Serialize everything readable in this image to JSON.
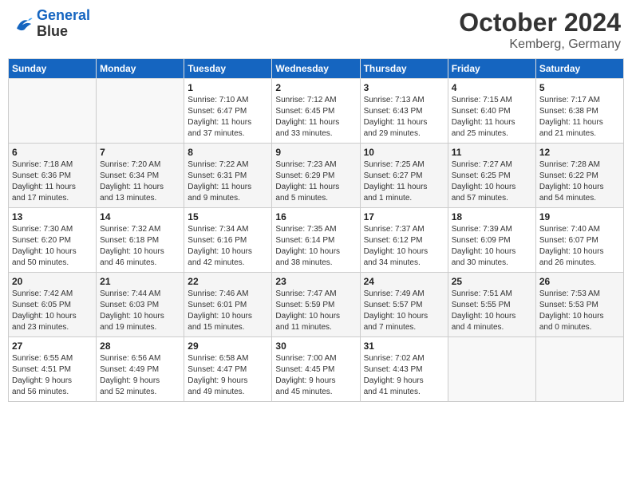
{
  "header": {
    "logo_line1": "General",
    "logo_line2": "Blue",
    "month": "October 2024",
    "location": "Kemberg, Germany"
  },
  "days_of_week": [
    "Sunday",
    "Monday",
    "Tuesday",
    "Wednesday",
    "Thursday",
    "Friday",
    "Saturday"
  ],
  "weeks": [
    [
      {
        "num": "",
        "detail": ""
      },
      {
        "num": "",
        "detail": ""
      },
      {
        "num": "1",
        "detail": "Sunrise: 7:10 AM\nSunset: 6:47 PM\nDaylight: 11 hours\nand 37 minutes."
      },
      {
        "num": "2",
        "detail": "Sunrise: 7:12 AM\nSunset: 6:45 PM\nDaylight: 11 hours\nand 33 minutes."
      },
      {
        "num": "3",
        "detail": "Sunrise: 7:13 AM\nSunset: 6:43 PM\nDaylight: 11 hours\nand 29 minutes."
      },
      {
        "num": "4",
        "detail": "Sunrise: 7:15 AM\nSunset: 6:40 PM\nDaylight: 11 hours\nand 25 minutes."
      },
      {
        "num": "5",
        "detail": "Sunrise: 7:17 AM\nSunset: 6:38 PM\nDaylight: 11 hours\nand 21 minutes."
      }
    ],
    [
      {
        "num": "6",
        "detail": "Sunrise: 7:18 AM\nSunset: 6:36 PM\nDaylight: 11 hours\nand 17 minutes."
      },
      {
        "num": "7",
        "detail": "Sunrise: 7:20 AM\nSunset: 6:34 PM\nDaylight: 11 hours\nand 13 minutes."
      },
      {
        "num": "8",
        "detail": "Sunrise: 7:22 AM\nSunset: 6:31 PM\nDaylight: 11 hours\nand 9 minutes."
      },
      {
        "num": "9",
        "detail": "Sunrise: 7:23 AM\nSunset: 6:29 PM\nDaylight: 11 hours\nand 5 minutes."
      },
      {
        "num": "10",
        "detail": "Sunrise: 7:25 AM\nSunset: 6:27 PM\nDaylight: 11 hours\nand 1 minute."
      },
      {
        "num": "11",
        "detail": "Sunrise: 7:27 AM\nSunset: 6:25 PM\nDaylight: 10 hours\nand 57 minutes."
      },
      {
        "num": "12",
        "detail": "Sunrise: 7:28 AM\nSunset: 6:22 PM\nDaylight: 10 hours\nand 54 minutes."
      }
    ],
    [
      {
        "num": "13",
        "detail": "Sunrise: 7:30 AM\nSunset: 6:20 PM\nDaylight: 10 hours\nand 50 minutes."
      },
      {
        "num": "14",
        "detail": "Sunrise: 7:32 AM\nSunset: 6:18 PM\nDaylight: 10 hours\nand 46 minutes."
      },
      {
        "num": "15",
        "detail": "Sunrise: 7:34 AM\nSunset: 6:16 PM\nDaylight: 10 hours\nand 42 minutes."
      },
      {
        "num": "16",
        "detail": "Sunrise: 7:35 AM\nSunset: 6:14 PM\nDaylight: 10 hours\nand 38 minutes."
      },
      {
        "num": "17",
        "detail": "Sunrise: 7:37 AM\nSunset: 6:12 PM\nDaylight: 10 hours\nand 34 minutes."
      },
      {
        "num": "18",
        "detail": "Sunrise: 7:39 AM\nSunset: 6:09 PM\nDaylight: 10 hours\nand 30 minutes."
      },
      {
        "num": "19",
        "detail": "Sunrise: 7:40 AM\nSunset: 6:07 PM\nDaylight: 10 hours\nand 26 minutes."
      }
    ],
    [
      {
        "num": "20",
        "detail": "Sunrise: 7:42 AM\nSunset: 6:05 PM\nDaylight: 10 hours\nand 23 minutes."
      },
      {
        "num": "21",
        "detail": "Sunrise: 7:44 AM\nSunset: 6:03 PM\nDaylight: 10 hours\nand 19 minutes."
      },
      {
        "num": "22",
        "detail": "Sunrise: 7:46 AM\nSunset: 6:01 PM\nDaylight: 10 hours\nand 15 minutes."
      },
      {
        "num": "23",
        "detail": "Sunrise: 7:47 AM\nSunset: 5:59 PM\nDaylight: 10 hours\nand 11 minutes."
      },
      {
        "num": "24",
        "detail": "Sunrise: 7:49 AM\nSunset: 5:57 PM\nDaylight: 10 hours\nand 7 minutes."
      },
      {
        "num": "25",
        "detail": "Sunrise: 7:51 AM\nSunset: 5:55 PM\nDaylight: 10 hours\nand 4 minutes."
      },
      {
        "num": "26",
        "detail": "Sunrise: 7:53 AM\nSunset: 5:53 PM\nDaylight: 10 hours\nand 0 minutes."
      }
    ],
    [
      {
        "num": "27",
        "detail": "Sunrise: 6:55 AM\nSunset: 4:51 PM\nDaylight: 9 hours\nand 56 minutes."
      },
      {
        "num": "28",
        "detail": "Sunrise: 6:56 AM\nSunset: 4:49 PM\nDaylight: 9 hours\nand 52 minutes."
      },
      {
        "num": "29",
        "detail": "Sunrise: 6:58 AM\nSunset: 4:47 PM\nDaylight: 9 hours\nand 49 minutes."
      },
      {
        "num": "30",
        "detail": "Sunrise: 7:00 AM\nSunset: 4:45 PM\nDaylight: 9 hours\nand 45 minutes."
      },
      {
        "num": "31",
        "detail": "Sunrise: 7:02 AM\nSunset: 4:43 PM\nDaylight: 9 hours\nand 41 minutes."
      },
      {
        "num": "",
        "detail": ""
      },
      {
        "num": "",
        "detail": ""
      }
    ]
  ]
}
